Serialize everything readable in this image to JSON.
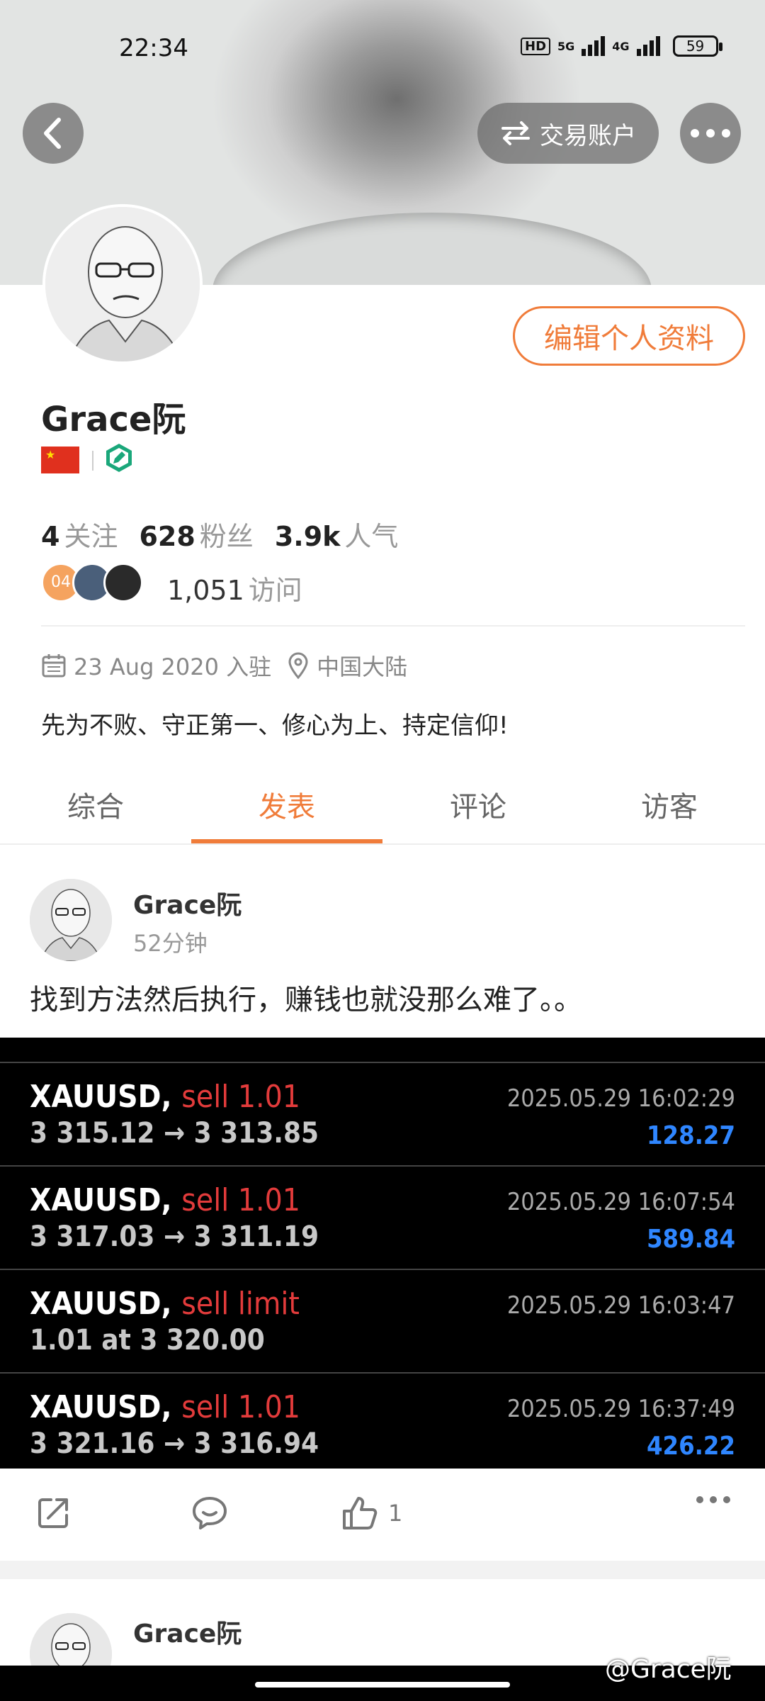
{
  "status_bar": {
    "time": "22:34",
    "hd": "HD",
    "net1": "5G",
    "net2": "4G",
    "battery": "59"
  },
  "header": {
    "trade_account_label": "交易账户"
  },
  "profile": {
    "name": "Grace阮",
    "edit_label": "编辑个人资料",
    "follow_count": "4",
    "follow_label": "关注",
    "fans_count": "628",
    "fans_label": "粉丝",
    "popularity_count": "3.9k",
    "popularity_label": "人气",
    "visitor_badge": "04",
    "visits_count": "1,051",
    "visits_label": "访问",
    "joined": "23 Aug 2020 入驻",
    "location": "中国大陆",
    "bio": "先为不败、守正第一、修心为上、持定信仰!"
  },
  "tabs": [
    {
      "label": "综合"
    },
    {
      "label": "发表"
    },
    {
      "label": "评论"
    },
    {
      "label": "访客"
    }
  ],
  "post": {
    "author": "Grace阮",
    "time": "52分钟",
    "text": "找到方法然后执行，赚钱也就没那么难了。。",
    "likes": "1",
    "trades": [
      {
        "symbol": "XAUUSD,",
        "side": "sell 1.01",
        "prices": "3 315.12 → 3 313.85",
        "date": "2025.05.29 16:02:29",
        "profit": "128.27"
      },
      {
        "symbol": "XAUUSD,",
        "side": "sell 1.01",
        "prices": "3 317.03 → 3 311.19",
        "date": "2025.05.29 16:07:54",
        "profit": "589.84"
      },
      {
        "symbol": "XAUUSD,",
        "side": "sell limit",
        "prices": "1.01 at 3 320.00",
        "date": "2025.05.29 16:03:47",
        "profit": ""
      },
      {
        "symbol": "XAUUSD,",
        "side": "sell 1.01",
        "prices": "3 321.16 → 3 316.94",
        "date": "2025.05.29 16:37:49",
        "profit": "426.22"
      }
    ]
  },
  "post2": {
    "author": "Grace阮"
  },
  "watermark": "@Grace阮",
  "colors": {
    "accent": "#f07c3a",
    "profit_blue": "#2f86ff",
    "sell_red": "#e23b3b"
  }
}
